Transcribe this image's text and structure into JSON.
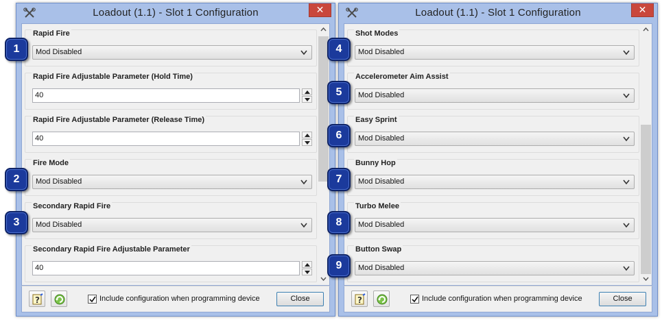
{
  "windows": [
    {
      "title": "Loadout (1.1) - Slot 1 Configuration",
      "close_glyph": "✕",
      "groups": [
        {
          "label": "Rapid Fire",
          "type": "select",
          "value": "Mod Disabled"
        },
        {
          "label": "Rapid Fire Adjustable Parameter (Hold Time)",
          "type": "spin",
          "value": "40"
        },
        {
          "label": "Rapid Fire Adjustable Parameter (Release Time)",
          "type": "spin",
          "value": "40"
        },
        {
          "label": "Fire Mode",
          "type": "select",
          "value": "Mod Disabled"
        },
        {
          "label": "Secondary Rapid Fire",
          "type": "select",
          "value": "Mod Disabled"
        },
        {
          "label": "Secondary Rapid Fire Adjustable Parameter",
          "type": "spin",
          "value": "40"
        }
      ],
      "badges": [
        "1",
        "2",
        "3"
      ],
      "footer": {
        "checkbox_label": "Include configuration when programming device",
        "checked": true,
        "close_label": "Close"
      }
    },
    {
      "title": "Loadout (1.1) - Slot 1 Configuration",
      "close_glyph": "✕",
      "groups": [
        {
          "label": "Shot Modes",
          "type": "select",
          "value": "Mod Disabled"
        },
        {
          "label": "Accelerometer Aim Assist",
          "type": "select",
          "value": "Mod Disabled"
        },
        {
          "label": "Easy Sprint",
          "type": "select",
          "value": "Mod Disabled"
        },
        {
          "label": "Bunny Hop",
          "type": "select",
          "value": "Mod Disabled"
        },
        {
          "label": "Turbo Melee",
          "type": "select",
          "value": "Mod Disabled"
        },
        {
          "label": "Button Swap",
          "type": "select",
          "value": "Mod Disabled"
        }
      ],
      "badges": [
        "4",
        "5",
        "6",
        "7",
        "8",
        "9"
      ],
      "footer": {
        "checkbox_label": "Include configuration when programming device",
        "checked": true,
        "close_label": "Close"
      }
    }
  ],
  "icons": {
    "title": "tools-icon",
    "help": "help-wizard-icon",
    "reset": "reset-arrow-icon"
  },
  "colors": {
    "window_frame": "#a9c0e8",
    "close_red": "#c9473c",
    "badge_blue": "#1b3a9c"
  }
}
